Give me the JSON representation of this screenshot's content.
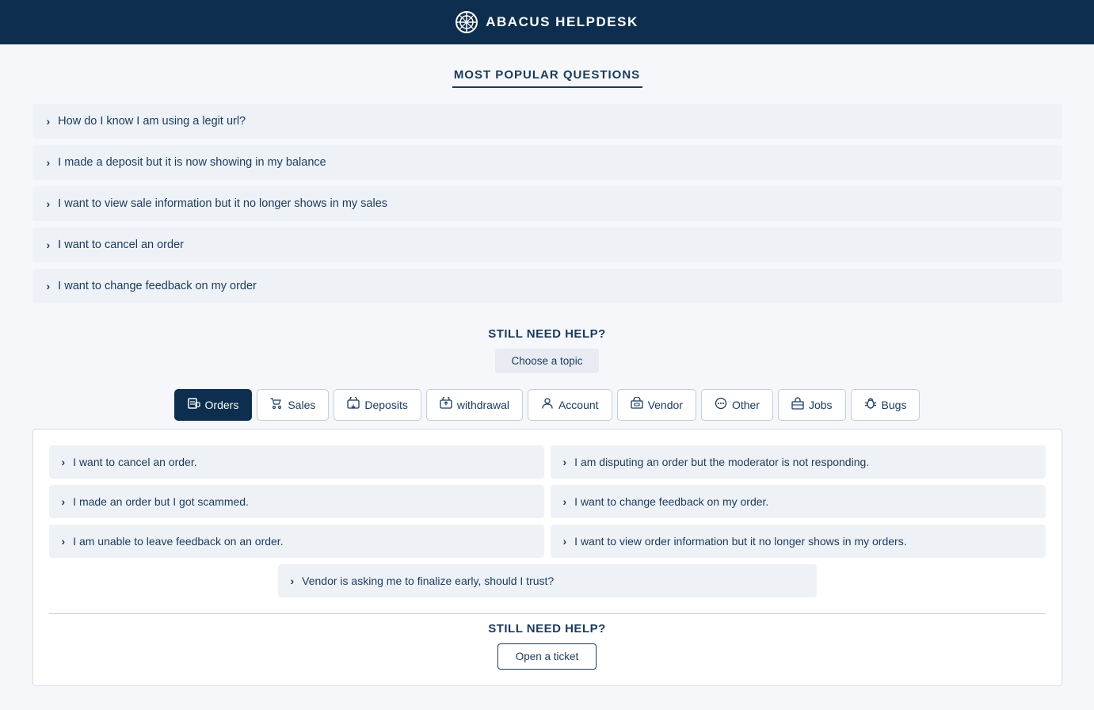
{
  "header": {
    "title": "ABACUS HELPDESK",
    "icon_label": "abacus-logo-icon"
  },
  "popular_section": {
    "title": "MOST POPULAR QUESTIONS",
    "items": [
      "How do I know I am using a legit url?",
      "I made a deposit but it is now showing in my balance",
      "I want to view sale information but it no longer shows in my sales",
      "I want to cancel an order",
      "I want to change feedback on my order"
    ]
  },
  "still_need_help": {
    "title": "STILL NEED HELP?",
    "choose_topic_label": "Choose a topic"
  },
  "topic_tabs": [
    {
      "id": "orders",
      "label": "Orders",
      "icon": "📋",
      "active": true
    },
    {
      "id": "sales",
      "label": "Sales",
      "icon": "🛒",
      "active": false
    },
    {
      "id": "deposits",
      "label": "Deposits",
      "icon": "↗",
      "active": false
    },
    {
      "id": "withdrawal",
      "label": "withdrawal",
      "icon": "↗",
      "active": false
    },
    {
      "id": "account",
      "label": "Account",
      "icon": "👤",
      "active": false
    },
    {
      "id": "vendor",
      "label": "Vendor",
      "icon": "🏷",
      "active": false
    },
    {
      "id": "other",
      "label": "Other",
      "icon": "💬",
      "active": false
    },
    {
      "id": "jobs",
      "label": "Jobs",
      "icon": "💼",
      "active": false
    },
    {
      "id": "bugs",
      "label": "Bugs",
      "icon": "🐛",
      "active": false
    }
  ],
  "orders_items": {
    "left_col": [
      "I want to cancel an order.",
      "I made an order but I got scammed.",
      "I am unable to leave feedback on an order."
    ],
    "right_col": [
      "I am disputing an order but the moderator is not responding.",
      "I want to change feedback on my order.",
      "I want to view order information but it no longer shows in my orders."
    ],
    "full_row": "Vendor is asking me to finalize early, should I trust?"
  },
  "bottom_help": {
    "title": "STILL NEED HELP?",
    "open_ticket_label": "Open a ticket"
  }
}
